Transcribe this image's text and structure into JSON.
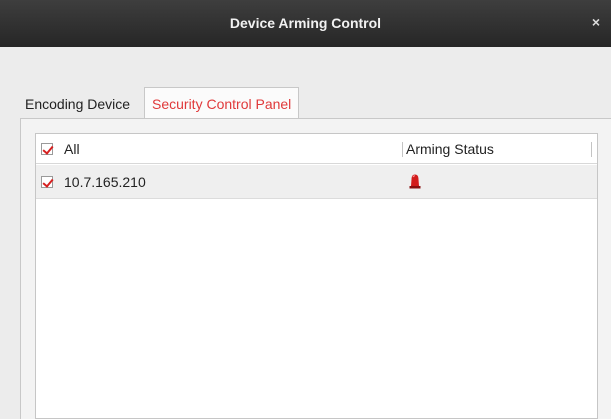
{
  "window": {
    "title": "Device Arming Control",
    "close_glyph": "×"
  },
  "tabs": [
    {
      "label": "Encoding Device",
      "active": false
    },
    {
      "label": "Security Control Panel",
      "active": true
    }
  ],
  "table": {
    "header": {
      "select_all_label": "All",
      "select_all_checked": true,
      "status_label": "Arming Status"
    },
    "rows": [
      {
        "device": "10.7.165.210",
        "checked": true,
        "status_icon": "alarm-siren-icon"
      }
    ]
  },
  "colors": {
    "active_tab_text": "#e0393a",
    "check_mark": "#d61f1f",
    "siren": "#d21c1c",
    "titlebar": "#2e2e2e"
  }
}
